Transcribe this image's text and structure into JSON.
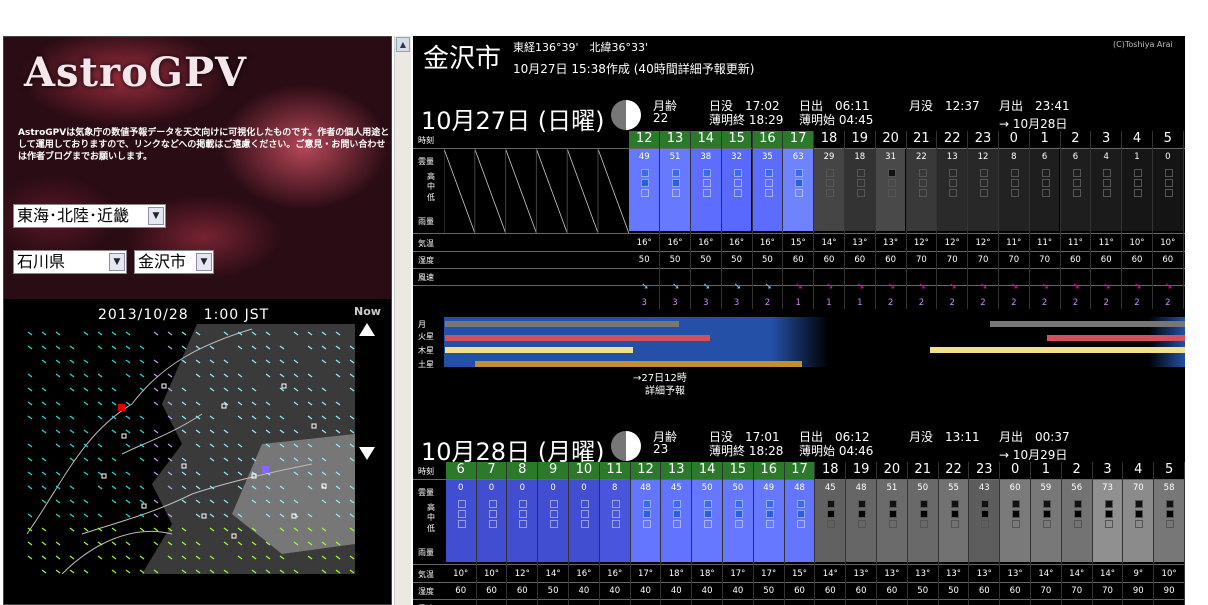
{
  "left": {
    "logo": "AstroGPV",
    "intro": "AstroGPVは気象庁の数値予報データを天文向けに可視化したものです。作者の個人用途として運用しておりますので、リンクなどへの掲載はご遠慮ください。ご意見・お問い合わせは作者ブログまでお願いします。",
    "region_select": "東海･北陸･近畿",
    "pref_select": "石川県",
    "city_select": "金沢市",
    "map_datetime": "2013/10/28　1:00 JST",
    "map_now": "Now"
  },
  "header": {
    "city": "金沢市",
    "coords": "東経136°39'　北緯36°33'",
    "updated": "10月27日 15:38作成 (40時間詳細予報更新)",
    "copyright": "(C)Toshiya Arai"
  },
  "row_labels": {
    "time": "時刻",
    "cloud": "雲量",
    "high": "高",
    "mid": "中",
    "low": "低",
    "rain": "雨量",
    "temp": "気温",
    "humidity": "湿度",
    "wind": "風速",
    "moon": "月",
    "mars": "火星",
    "jupiter": "木星",
    "saturn": "土星"
  },
  "days": [
    {
      "date": "10月27日 (日曜)",
      "moon_age_label": "月齢",
      "moon_age": "22",
      "sunset": "日没　17:02",
      "twilight_end": "薄明終 18:29",
      "sunrise": "日出　06:11",
      "twilight_start": "薄明始 04:45",
      "moonset": "月没　12:37",
      "moonrise": "月出　23:41",
      "next_day": "→ 10月28日",
      "hours": [
        "12",
        "13",
        "14",
        "15",
        "16",
        "17",
        "18",
        "19",
        "20",
        "21",
        "22",
        "23",
        "0",
        "1",
        "2",
        "3",
        "4",
        "5"
      ],
      "cloud": [
        "49",
        "51",
        "38",
        "32",
        "35",
        "63",
        "29",
        "18",
        "31",
        "22",
        "13",
        "12",
        "8",
        "6",
        "6",
        "4",
        "1",
        "0"
      ],
      "temp": [
        "16°",
        "16°",
        "16°",
        "16°",
        "16°",
        "15°",
        "14°",
        "13°",
        "13°",
        "12°",
        "12°",
        "12°",
        "11°",
        "11°",
        "11°",
        "11°",
        "10°",
        "10°"
      ],
      "humidity": [
        "50",
        "50",
        "50",
        "50",
        "50",
        "60",
        "60",
        "60",
        "60",
        "70",
        "70",
        "70",
        "70",
        "70",
        "60",
        "60",
        "60",
        "60"
      ],
      "wind": [
        "3",
        "3",
        "3",
        "3",
        "2",
        "1",
        "1",
        "1",
        "2",
        "2",
        "2",
        "2",
        "2",
        "2",
        "2",
        "2",
        "2",
        "2"
      ],
      "note1": "→27日12時",
      "note2": "詳細予報"
    },
    {
      "date": "10月28日 (月曜)",
      "moon_age_label": "月齢",
      "moon_age": "23",
      "sunset": "日没　17:01",
      "twilight_end": "薄明終 18:28",
      "sunrise": "日出　06:12",
      "twilight_start": "薄明始 04:46",
      "moonset": "月没　13:11",
      "moonrise": "月出　00:37",
      "next_day": "→ 10月29日",
      "hours": [
        "6",
        "7",
        "8",
        "9",
        "10",
        "11",
        "12",
        "13",
        "14",
        "15",
        "16",
        "17",
        "18",
        "19",
        "20",
        "21",
        "22",
        "23",
        "0",
        "1",
        "2",
        "3",
        "4",
        "5"
      ],
      "cloud": [
        "0",
        "0",
        "0",
        "0",
        "0",
        "8",
        "48",
        "45",
        "50",
        "50",
        "49",
        "48",
        "45",
        "48",
        "51",
        "50",
        "55",
        "43",
        "60",
        "59",
        "56",
        "73",
        "70",
        "58"
      ],
      "temp": [
        "10°",
        "10°",
        "12°",
        "14°",
        "16°",
        "16°",
        "17°",
        "18°",
        "18°",
        "17°",
        "17°",
        "15°",
        "14°",
        "13°",
        "13°",
        "13°",
        "13°",
        "13°",
        "13°",
        "14°",
        "14°",
        "14°",
        "9°",
        "10°"
      ],
      "humidity": [
        "60",
        "60",
        "60",
        "50",
        "40",
        "40",
        "40",
        "40",
        "40",
        "40",
        "50",
        "60",
        "60",
        "60",
        "60",
        "50",
        "50",
        "60",
        "60",
        "70",
        "70",
        "70",
        "90",
        "90"
      ]
    }
  ]
}
